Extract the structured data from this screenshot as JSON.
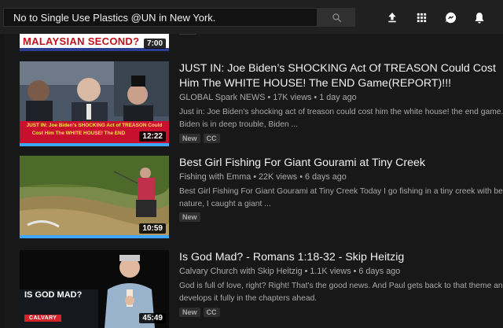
{
  "search": {
    "value": "No to Single Use Plastics @UN in New York."
  },
  "header_icons": [
    "search-icon",
    "upload-icon",
    "apps-grid-icon",
    "messages-icon",
    "notifications-bell-icon"
  ],
  "colors": {
    "background": "#181818",
    "masthead": "#202020",
    "progress": "#3ea6ff",
    "meta": "#aaaaaa"
  },
  "top_partial": {
    "thumb_text": "MALAYSIAN SECOND?",
    "duration": "7:00"
  },
  "videos": [
    {
      "title_line1": "JUST IN: Joe Biden’s SHOCKING Act Of TREASON Could Cost",
      "title_line2": "Him The WHITE HOUSE! The END Game(REPORT)!!!",
      "channel": "GLOBAL Spark NEWS",
      "views": "17K views",
      "age": "1 day ago",
      "desc_line1": "Just in: Joe Biden's shocking act of treason could cost him the white house! the end game. Joe",
      "desc_line2": "Biden is in deep trouble, Biden ...",
      "badges": [
        "New",
        "CC"
      ],
      "duration": "12:22",
      "thumb_caption1": "JUST IN: Joe Biden's SHOCKING Act of TREASON Could",
      "thumb_caption2": "Cost Him The WHITE HOUSE! The END"
    },
    {
      "title_line1": "Best Girl Fishing For Giant Gourami at Tiny Creek",
      "channel": "Fishing with Emma",
      "views": "22K views",
      "age": "6 days ago",
      "desc_line1": "Best Girl Fishing For Giant Gourami at Tiny Creek Today I go fishing in a tiny creek with beautiful",
      "desc_line2": "nature, I caught a giant ...",
      "badges": [
        "New"
      ],
      "duration": "10:59"
    },
    {
      "title_line1": "Is God Mad? - Romans 1:18-32 - Skip Heitzig",
      "channel": "Calvary Church with Skip Heitzig",
      "views": "1.1K views",
      "age": "6 days ago",
      "desc_line1": "God is full of love, right? Right! That's the good news. And Paul gets back to that theme and",
      "desc_line2": "develops it fully in the chapters ahead.",
      "badges": [
        "New",
        "CC"
      ],
      "duration": "45:49",
      "thumb_caption1": "IS GOD MAD?",
      "thumb_caption2": "CALVARY"
    }
  ]
}
